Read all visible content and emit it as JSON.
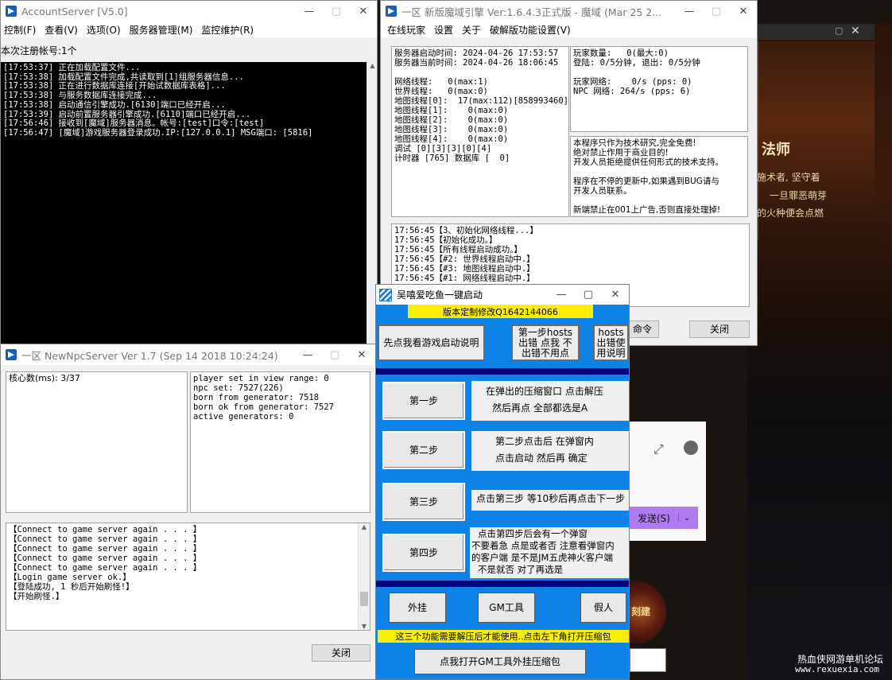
{
  "colors": {
    "accent_blue": "#0d83e8",
    "yellow": "#ffee00",
    "purple": "#b07af0",
    "navy": "#00007a"
  },
  "account_server": {
    "title": "AccountServer [V5.0]",
    "menus": [
      "控制(F)",
      "查看(V)",
      "选项(O)",
      "服务器管理(M)",
      "监控维护(R)"
    ],
    "status": "本次注册帐号:1个",
    "log": [
      "[17:53:37] 正在加载配置文件...",
      "[17:53:38] 加载配置文件完成,共读取到[1]组服务器信息...",
      "[17:53:38] 正在进行数据库连接[开始试数据库表格]...",
      "[17:53:38] 与服务数据库连接完成...",
      "[17:53:38] 启动通信引擎成功.[6130]端口已经开启...",
      "[17:53:39] 启动前置服务器引擎成功.[6110]端口已经开启...",
      "[17:56:46] 接收到[魔域]服务器消息。帐号:[test]口令:[test]",
      "[17:56:47] [魔域]游戏服务器登录成功.IP:[127.0.0.1] MSG端口: [5816]"
    ]
  },
  "npc_server": {
    "title": "一区 NewNpcServer Ver 1.7 (Sep 14 2018 10:24:24)",
    "core_label": "核心数(ms): 3/37",
    "stats": [
      "player set in view range: 0",
      "npc set: 7527(226)",
      "born from generator: 7518",
      "born ok from generator: 7527",
      "active generators: 0"
    ],
    "log": [
      "【Connect to game server again . . . 】",
      "【Connect to game server again . . . 】",
      "【Connect to game server again . . . 】",
      "【Connect to game server again . . . 】",
      "【Connect to game server again . . . 】",
      "【Login game server ok.】",
      "【登陆成功, 1 秒后开始刷怪!】",
      "【开始刷怪.】"
    ],
    "close_label": "关闭"
  },
  "game_engine": {
    "title": "一区 新版魔域引擎 Ver:1.6.4.3正式版 - 魔域 (Mar 25 2...",
    "menus": [
      "在线玩家",
      "设置",
      "关于",
      "破解版功能设置(V)"
    ],
    "info_left": [
      "服务器启动时间: 2024-04-26 17:53:57",
      "服务器当前时间: 2024-04-26 18:06:45",
      "",
      "网络线程:   0(max:1)",
      "世界线程:   0(max:0)",
      "地图线程[0]:  17(max:112)[858993460]",
      "地图线程[1]:    0(max:0)",
      "地图线程[2]:    0(max:0)",
      "地图线程[3]:    0(max:0)",
      "地图线程[4]:    0(max:0)",
      "调试 [0][3][3][0][4]",
      "计时器 [765] 数据库 [  0]"
    ],
    "info_right_top": [
      "玩家数量:   0(最大:0)",
      "登陆: 0/5分钟, 退出: 0/5分钟",
      "",
      "玩家网络:    0/s (pps: 0)",
      "NPC 网络: 264/s (pps: 6)"
    ],
    "notice": [
      "本程序只作为技术研究,完全免费!",
      "绝对禁止作用于商业目的!",
      "开发人员拒绝提供任何形式的技术支持。",
      "",
      "程序在不停的更新中,如果遇到BUG请与",
      "开发人员联系。",
      "",
      "新端禁止在001上广告,否则直接处理掉!"
    ],
    "log": [
      "17:56:45【3、初始化网络线程...】",
      "17:56:45【初始化成功。】",
      "17:56:45【所有线程启动成功。】",
      "17:56:45【#2: 世界线程启动中.】",
      "17:56:45【#3: 地图线程启动中.】",
      "17:56:45【#1: 网络线程启动中.】"
    ],
    "cmd_label": "命令",
    "close_label": "关闭"
  },
  "launcher": {
    "title": "吴嘻爱吃鱼一键启动",
    "banner": "版本定制修改Q1642144066",
    "btn_guide": "先点我看游戏启动说明",
    "btn_step1_hosts": "第一步hosts出错 点我 不出错不用点",
    "btn_hosts_help": "hosts出错使用说明",
    "steps": [
      {
        "label": "第一步",
        "desc": [
          "在弹出的压缩窗口 点击解压",
          "然后再点 全部都选是A"
        ]
      },
      {
        "label": "第二步",
        "desc": [
          "第二步点击后 在弹窗内",
          "点击启动 然后再 确定"
        ]
      },
      {
        "label": "第三步",
        "desc": [
          "点击第三步 等10秒后再点击下一步"
        ]
      },
      {
        "label": "第四步",
        "desc": [
          "点击第四步后会有一个弹窗",
          "不要着急  点是或者否 注意看弹窗内",
          "的客户端 是不是JM五虎神火客户端",
          "不是就否 对了再选是"
        ]
      }
    ],
    "tools": [
      "外挂",
      "GM工具",
      "假人"
    ],
    "warning": "这三个功能需要解压后才能使用..点击左下角打开压缩包",
    "open_zip": "点我打开GM工具外挂压缩包"
  },
  "game_bg": {
    "class_title": "法师",
    "lines": [
      "施术者, 坚守着",
      "一旦罪恶萌芽",
      "的火种便会点燃"
    ],
    "send_label": "发送(S)",
    "badge": "刻建",
    "watermark1": "热血侠网游单机论坛",
    "watermark2": "www.rexuexia.com"
  }
}
